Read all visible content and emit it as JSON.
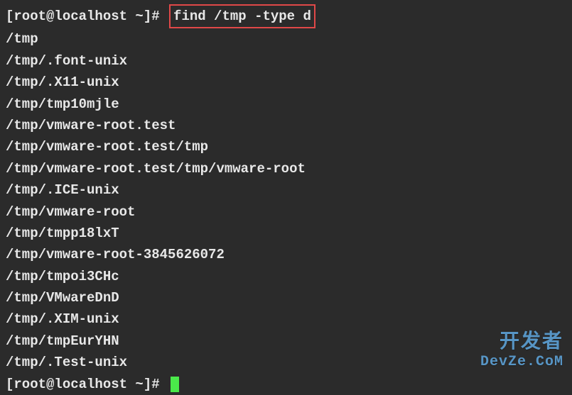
{
  "prompt": {
    "user_host": "[root@localhost ~]#",
    "command": "find /tmp -type d"
  },
  "output_lines": [
    "/tmp",
    "/tmp/.font-unix",
    "/tmp/.X11-unix",
    "/tmp/tmp10mjle",
    "/tmp/vmware-root.test",
    "/tmp/vmware-root.test/tmp",
    "/tmp/vmware-root.test/tmp/vmware-root",
    "/tmp/.ICE-unix",
    "/tmp/vmware-root",
    "/tmp/tmpp18lxT",
    "/tmp/vmware-root-3845626072",
    "/tmp/tmpoi3CHc",
    "/tmp/VMwareDnD",
    "/tmp/.XIM-unix",
    "/tmp/tmpEurYHN",
    "/tmp/.Test-unix"
  ],
  "prompt_end": "[root@localhost ~]#",
  "watermark": {
    "top": "开发者",
    "bottom": "DevZe.CoM"
  }
}
